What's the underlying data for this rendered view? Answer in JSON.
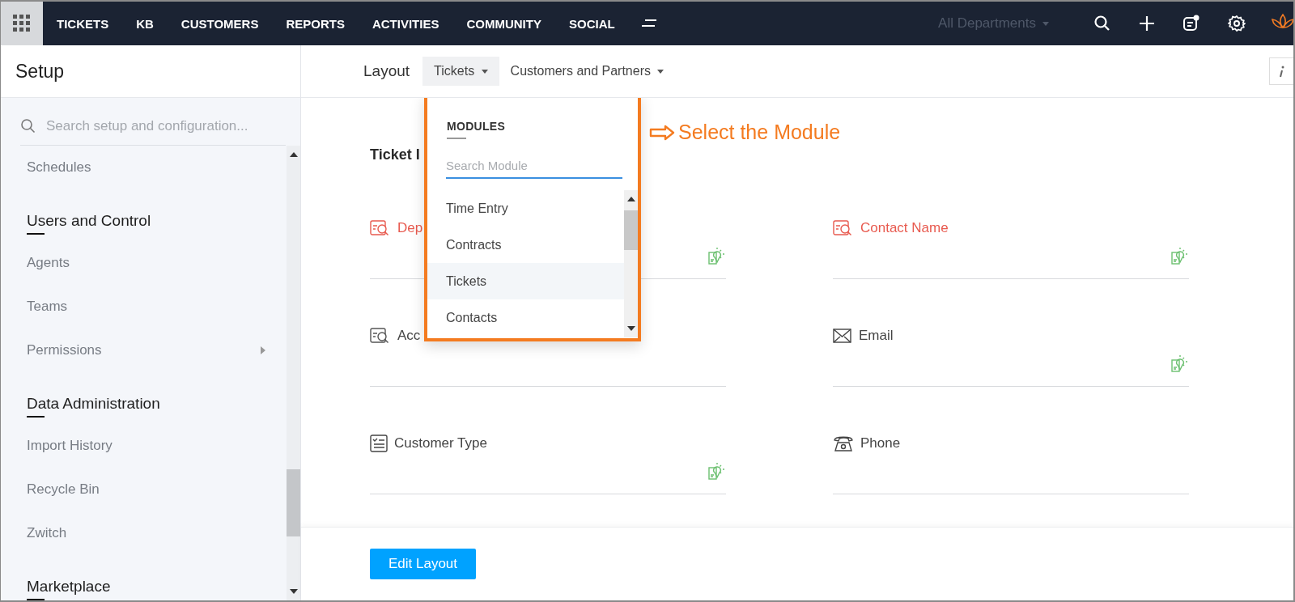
{
  "topbar": {
    "nav": [
      {
        "label": "TICKETS"
      },
      {
        "label": "KB"
      },
      {
        "label": "CUSTOMERS"
      },
      {
        "label": "REPORTS"
      },
      {
        "label": "ACTIVITIES"
      },
      {
        "label": "COMMUNITY"
      },
      {
        "label": "SOCIAL"
      }
    ],
    "department": "All Departments"
  },
  "sidebar": {
    "title": "Setup",
    "search": {
      "placeholder": "Search setup and configuration..."
    },
    "items": [
      {
        "kind": "item",
        "label": "Schedules"
      },
      {
        "kind": "heading",
        "label": "Users and Control"
      },
      {
        "kind": "item",
        "label": "Agents"
      },
      {
        "kind": "item",
        "label": "Teams"
      },
      {
        "kind": "item",
        "label": "Permissions",
        "submenu": true
      },
      {
        "kind": "heading",
        "label": "Data Administration"
      },
      {
        "kind": "item",
        "label": "Import History"
      },
      {
        "kind": "item",
        "label": "Recycle Bin"
      },
      {
        "kind": "item",
        "label": "Zwitch"
      },
      {
        "kind": "heading",
        "label": "Marketplace"
      }
    ]
  },
  "layout_bar": {
    "label": "Layout",
    "tabs": [
      {
        "label": "Tickets",
        "selected": true
      },
      {
        "label": "Customers and Partners",
        "selected": false
      }
    ]
  },
  "section_title": "Ticket I",
  "fields": [
    {
      "label": "Dep",
      "kind": "lookup",
      "required": true,
      "suggest": true
    },
    {
      "label": "Contact Name",
      "kind": "lookup",
      "required": true,
      "suggest": true
    },
    {
      "label": "Acc",
      "kind": "lookup",
      "required": false,
      "suggest": false
    },
    {
      "label": "Email",
      "kind": "email",
      "required": false,
      "suggest": true
    },
    {
      "label": "Customer Type",
      "kind": "list",
      "required": false,
      "suggest": true
    },
    {
      "label": "Phone",
      "kind": "phone",
      "required": false,
      "suggest": false
    }
  ],
  "dropdown": {
    "title": "MODULES",
    "search": {
      "placeholder": "Search Module"
    },
    "items": [
      {
        "label": "Time Entry",
        "selected": false
      },
      {
        "label": "Contracts",
        "selected": false
      },
      {
        "label": "Tickets",
        "selected": true
      },
      {
        "label": "Contacts",
        "selected": false
      }
    ]
  },
  "annotation": "Select the Module",
  "footer": {
    "button": "Edit Layout"
  }
}
